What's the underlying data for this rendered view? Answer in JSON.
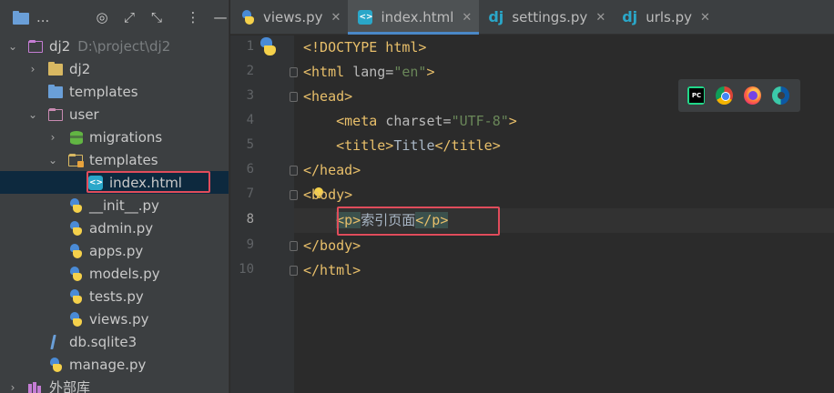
{
  "sidebar": {
    "toolbar": {
      "project_label": "...",
      "icons": [
        "target-icon",
        "expand-icon",
        "collapse-icon",
        "more-icon",
        "minimize-icon"
      ]
    },
    "tree": [
      {
        "label": "dj2",
        "path": "D:\\project\\dj2",
        "arrow": "⌄",
        "depth": 0,
        "icon": "project-folder-icon"
      },
      {
        "label": "dj2",
        "arrow": "›",
        "depth": 1,
        "icon": "package-folder-icon"
      },
      {
        "label": "templates",
        "arrow": "",
        "depth": 1,
        "icon": "templates-folder-icon"
      },
      {
        "label": "user",
        "arrow": "⌄",
        "depth": 1,
        "icon": "app-folder-icon"
      },
      {
        "label": "migrations",
        "arrow": "›",
        "depth": 2,
        "icon": "migrations-folder-icon"
      },
      {
        "label": "templates",
        "arrow": "⌄",
        "depth": 2,
        "icon": "templates-folder-icon"
      },
      {
        "label": "index.html",
        "arrow": "",
        "depth": 3,
        "icon": "html-file-icon",
        "selected": true
      },
      {
        "label": "__init__.py",
        "arrow": "",
        "depth": 2,
        "icon": "python-file-icon"
      },
      {
        "label": "admin.py",
        "arrow": "",
        "depth": 2,
        "icon": "python-file-icon"
      },
      {
        "label": "apps.py",
        "arrow": "",
        "depth": 2,
        "icon": "python-file-icon"
      },
      {
        "label": "models.py",
        "arrow": "",
        "depth": 2,
        "icon": "python-file-icon"
      },
      {
        "label": "tests.py",
        "arrow": "",
        "depth": 2,
        "icon": "python-file-icon"
      },
      {
        "label": "views.py",
        "arrow": "",
        "depth": 2,
        "icon": "python-file-icon"
      },
      {
        "label": "db.sqlite3",
        "arrow": "",
        "depth": 1,
        "icon": "database-file-icon"
      },
      {
        "label": "manage.py",
        "arrow": "",
        "depth": 1,
        "icon": "python-file-icon"
      },
      {
        "label": "外部库",
        "arrow": "›",
        "depth": 0,
        "icon": "external-libraries-icon"
      }
    ]
  },
  "tabs": [
    {
      "label": "views.py",
      "icon": "python-file-icon",
      "close": "✕",
      "active": false
    },
    {
      "label": "index.html",
      "icon": "html-file-icon",
      "close": "✕",
      "active": true
    },
    {
      "label": "settings.py",
      "icon": "django-icon",
      "close": "✕",
      "active": false
    },
    {
      "label": "urls.py",
      "icon": "django-icon",
      "close": "✕",
      "active": false
    }
  ],
  "editor": {
    "current_line": 8,
    "line_numbers": [
      "1",
      "2",
      "3",
      "4",
      "5",
      "6",
      "7",
      "8",
      "9",
      "10"
    ],
    "lines": [
      "<!DOCTYPE html>",
      "<html lang=\"en\">",
      "<head>",
      "    <meta charset=\"UTF-8\">",
      "    <title>Title</title>",
      "</head>",
      "<body>",
      "    <p>索引页面</p>",
      "</body>",
      "</html>"
    ],
    "tokens": {
      "l1": "<!DOCTYPE html>",
      "l2_tag": "<html ",
      "l2_attr": "lang=",
      "l2_val": "\"en\"",
      "l2_end": ">",
      "l3": "<head>",
      "l4_indent": "    ",
      "l4_tag": "<meta ",
      "l4_attr": "charset=",
      "l4_val": "\"UTF-8\"",
      "l4_end": ">",
      "l5_indent": "    ",
      "l5_open": "<title>",
      "l5_text": "Title",
      "l5_close": "</title>",
      "l6": "</head>",
      "l7": "<body>",
      "l8_indent": "    ",
      "l8_open": "<p>",
      "l8_text": "索引页面",
      "l8_close": "</p>",
      "l9": "</body>",
      "l10": "</html>"
    },
    "browser_icons": [
      "pycharm-icon",
      "chrome-icon",
      "firefox-icon",
      "edge-icon"
    ]
  },
  "colors": {
    "highlight_border": "#e04c5b",
    "tab_accent": "#4a88c7",
    "tag": "#e8bf6a",
    "string": "#6a8759"
  }
}
